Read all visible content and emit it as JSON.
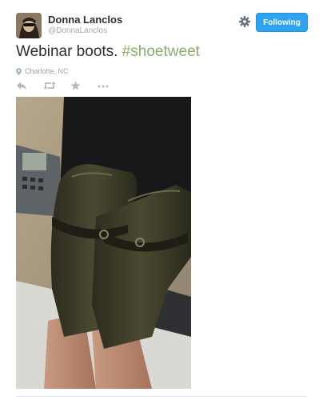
{
  "user": {
    "display_name": "Donna Lanclos",
    "screen_name": "@DonnaLanclos"
  },
  "follow_button": {
    "label": "Following"
  },
  "tweet": {
    "text": "Webinar boots. ",
    "hashtag": "#shoetweet",
    "location": "Charlotte, NC"
  },
  "icons": {
    "settings": "gear-icon",
    "reply": "reply-icon",
    "retweet": "retweet-icon",
    "favorite": "star-icon",
    "more": "more-icon",
    "location": "map-pin-icon"
  },
  "colors": {
    "follow_button": "#2ea3ef",
    "hashtag": "#8cab6f",
    "muted_text": "#a0aab2"
  }
}
